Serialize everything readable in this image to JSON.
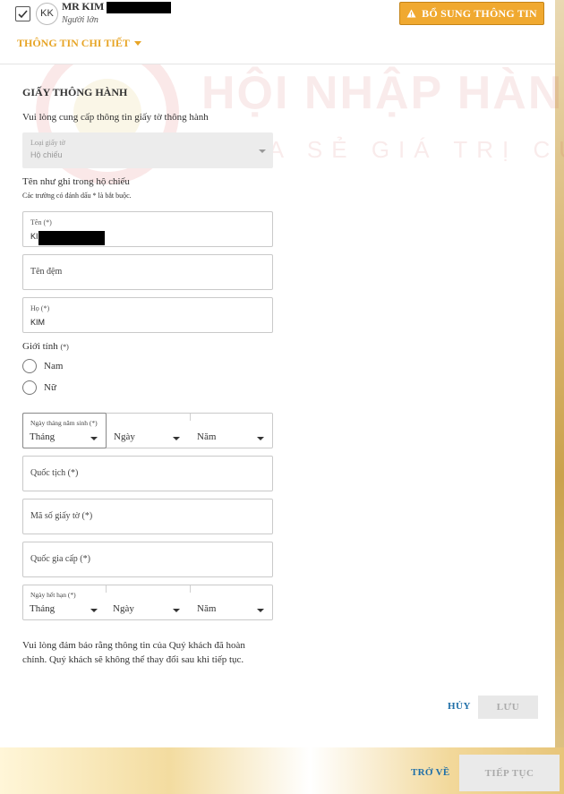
{
  "passenger": {
    "initials": "KK",
    "name": "MR KIM",
    "type": "Người lớn",
    "selected": true
  },
  "header": {
    "warning_button": "BỔ SUNG THÔNG TIN",
    "details_toggle": "THÔNG TIN CHI TIẾT"
  },
  "watermark": {
    "title": "HỘI NHẬP HÀN Q",
    "subtitle": "CHIA SẺ GIÁ TRỊ CUỘC"
  },
  "form": {
    "section_title": "GIẤY THÔNG HÀNH",
    "intro": "Vui lòng cung cấp thông tin giấy tờ thông hành",
    "doc_type": {
      "label": "Loại giấy tờ",
      "value": "Hộ chiếu"
    },
    "name_heading": "Tên như ghi trong hộ chiếu",
    "required_note": "Các trường có đánh dấu * là bắt buộc.",
    "first_name": {
      "label": "Tên (*)",
      "value": "KI"
    },
    "middle_name": {
      "placeholder": "Tên đệm"
    },
    "last_name": {
      "label": "Họ (*)",
      "value": "KIM"
    },
    "gender": {
      "label": "Giới tính",
      "required": "(*)",
      "options": [
        "Nam",
        "Nữ"
      ]
    },
    "dob": {
      "label": "Ngày tháng năm sinh (*)",
      "month": "Tháng",
      "day": "Ngày",
      "year": "Năm"
    },
    "nationality": {
      "placeholder": "Quốc tịch (*)"
    },
    "doc_number": {
      "placeholder": "Mã số giấy tờ (*)"
    },
    "issuing_country": {
      "placeholder": "Quốc gia cấp (*)"
    },
    "expiry": {
      "label": "Ngày hết hạn (*)",
      "month": "Tháng",
      "day": "Ngày",
      "year": "Năm"
    },
    "notice": "Vui lòng đảm bảo rằng thông tin của Quý khách đã hoàn chỉnh. Quý khách sẽ không thể thay đổi sau khi tiếp tục.",
    "cancel": "HỦY",
    "save": "LƯU"
  },
  "footer": {
    "back": "TRỞ VỀ",
    "continue": "TIẾP TỤC"
  },
  "colors": {
    "accent": "#e7a527",
    "warning_bg": "#f0a930",
    "link": "#1f6fa8",
    "disabled_bg": "#e8e8e8"
  }
}
